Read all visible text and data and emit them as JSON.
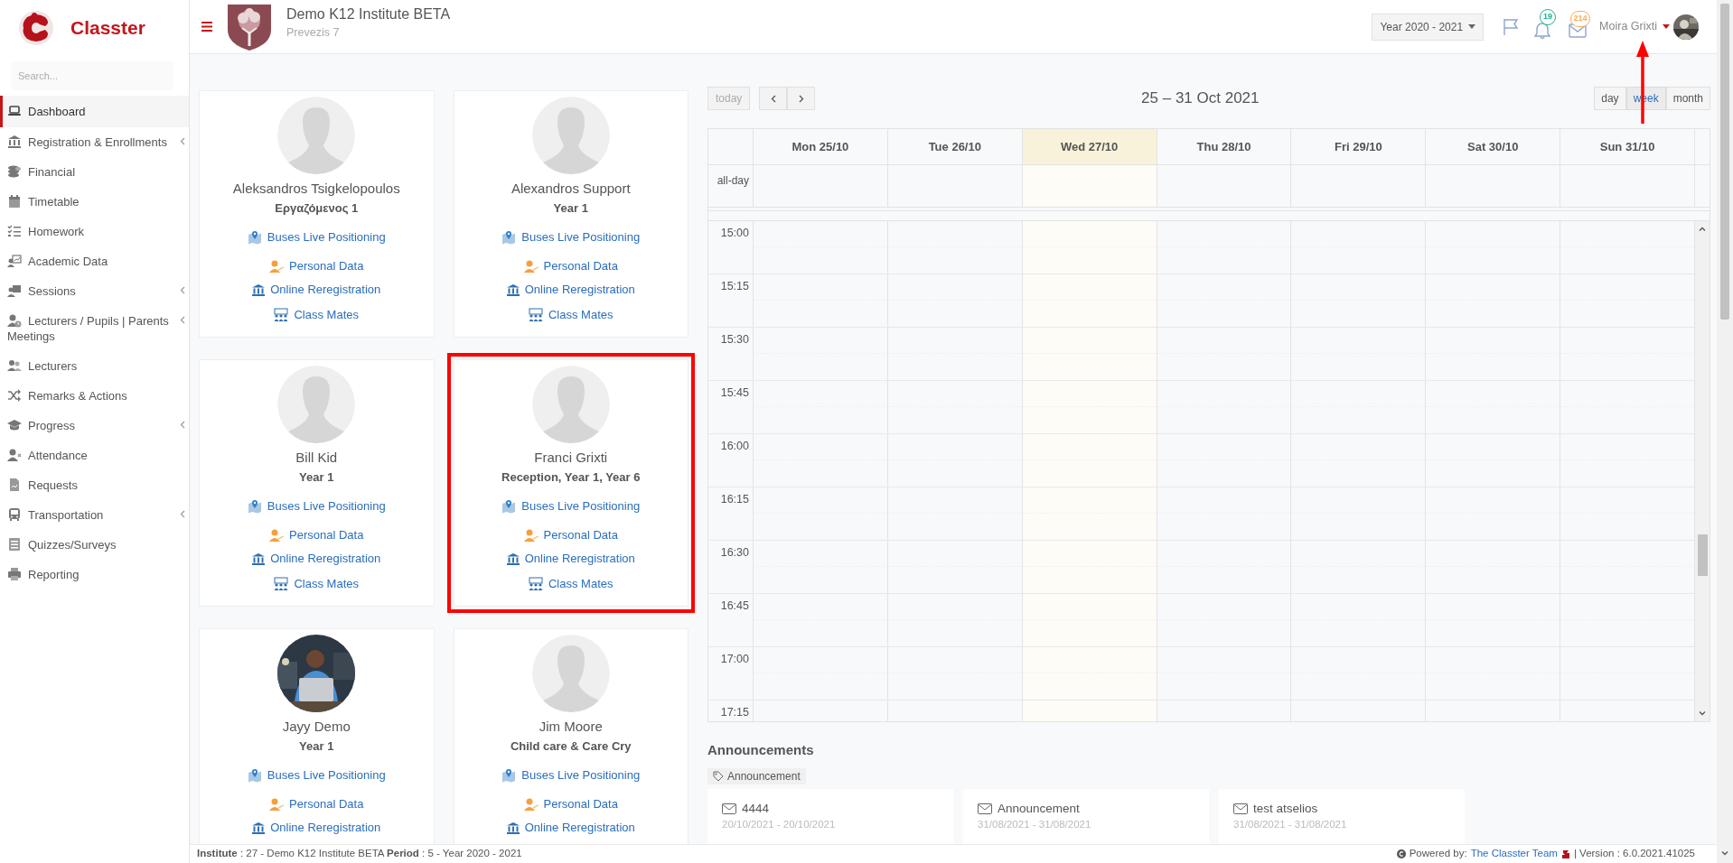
{
  "sidebar": {
    "brand": "Classter",
    "search": {
      "placeholder": "Search..."
    },
    "items": [
      {
        "label": "Dashboard",
        "selected": true,
        "expandable": false
      },
      {
        "label": "Registration & Enrollments",
        "selected": false,
        "expandable": true
      },
      {
        "label": "Financial",
        "selected": false,
        "expandable": false
      },
      {
        "label": "Timetable",
        "selected": false,
        "expandable": false
      },
      {
        "label": "Homework",
        "selected": false,
        "expandable": false
      },
      {
        "label": "Academic Data",
        "selected": false,
        "expandable": false
      },
      {
        "label": "Sessions",
        "selected": false,
        "expandable": true
      },
      {
        "label": "Lecturers / Pupils | Parents Meetings",
        "selected": false,
        "expandable": true
      },
      {
        "label": "Lecturers",
        "selected": false,
        "expandable": false
      },
      {
        "label": "Remarks & Actions",
        "selected": false,
        "expandable": false
      },
      {
        "label": "Progress",
        "selected": false,
        "expandable": true
      },
      {
        "label": "Attendance",
        "selected": false,
        "expandable": false
      },
      {
        "label": "Requests",
        "selected": false,
        "expandable": false
      },
      {
        "label": "Transportation",
        "selected": false,
        "expandable": true
      },
      {
        "label": "Quizzes/Surveys",
        "selected": false,
        "expandable": false
      },
      {
        "label": "Reporting",
        "selected": false,
        "expandable": false
      }
    ]
  },
  "header": {
    "institute": "Demo K12 Institute BETA",
    "address": "Prevezis 7",
    "year_select": "Year 2020 - 2021",
    "notifications": "19",
    "messages": "214",
    "user": "Moira Grixti",
    "annotation_arrow": true
  },
  "students": [
    {
      "name": "Aleksandros Tsigkelopoulos",
      "class": "Εργαζόμενος 1",
      "kind": "placeholder",
      "highlighted": false,
      "links": [
        "Buses Live Positioning",
        "Personal Data",
        "Online Reregistration",
        "Class Mates"
      ]
    },
    {
      "name": "Alexandros Support",
      "class": "Year 1",
      "kind": "placeholder",
      "highlighted": false,
      "links": [
        "Buses Live Positioning",
        "Personal Data",
        "Online Reregistration",
        "Class Mates"
      ]
    },
    {
      "name": "Bill Kid",
      "class": "Year 1",
      "kind": "placeholder",
      "highlighted": false,
      "links": [
        "Buses Live Positioning",
        "Personal Data",
        "Online Reregistration",
        "Class Mates"
      ]
    },
    {
      "name": "Franci Grixti",
      "class": "Reception, Year 1, Year 6",
      "kind": "placeholder",
      "highlighted": true,
      "links": [
        "Buses Live Positioning",
        "Personal Data",
        "Online Reregistration",
        "Class Mates"
      ]
    },
    {
      "name": "Jayy Demo",
      "class": "Year 1",
      "highlighted": false,
      "links": [
        "Buses Live Positioning",
        "Personal Data",
        "Online Reregistration"
      ]
    },
    {
      "name": "Jim Moore",
      "class": "Child care & Care Cry",
      "kind": "placeholder",
      "highlighted": false,
      "links": [
        "Buses Live Positioning",
        "Personal Data",
        "Online Reregistration"
      ]
    }
  ],
  "calendar": {
    "today_button": {
      "label": "today",
      "disabled": true
    },
    "range": "25 – 31 Oct 2021",
    "views": [
      {
        "label": "day",
        "selected": false
      },
      {
        "label": "week",
        "selected": true
      },
      {
        "label": "month",
        "selected": false
      }
    ],
    "days": [
      {
        "label": "Mon 25/10",
        "today": false
      },
      {
        "label": "Tue 26/10",
        "today": false
      },
      {
        "label": "Wed 27/10",
        "today": true
      },
      {
        "label": "Thu 28/10",
        "today": false
      },
      {
        "label": "Fri 29/10",
        "today": false
      },
      {
        "label": "Sat 30/10",
        "today": false
      },
      {
        "label": "Sun 31/10",
        "today": false
      }
    ],
    "allday_label": "all-day",
    "times": [
      "15:00",
      "15:15",
      "15:30",
      "15:45",
      "16:00",
      "16:15",
      "16:30",
      "16:45",
      "17:00",
      "17:15"
    ]
  },
  "announcements": {
    "title": "Announcements",
    "tag": "Announcement",
    "items": [
      {
        "title": "4444",
        "dates": "20/10/2021 - 20/10/2021"
      },
      {
        "title": "Announcement",
        "dates": "31/08/2021 - 31/08/2021"
      },
      {
        "title": "test atselios",
        "dates": "31/08/2021 - 31/08/2021"
      }
    ]
  },
  "footer": {
    "info": "**Institute** : 27 - Demo K12 Institute BETA **Period** : 5 - Year 2020 - 2021",
    "powered": "Powered by:",
    "team": "The Classter Team",
    "version": "| Version : 6.0.2021.41025"
  }
}
